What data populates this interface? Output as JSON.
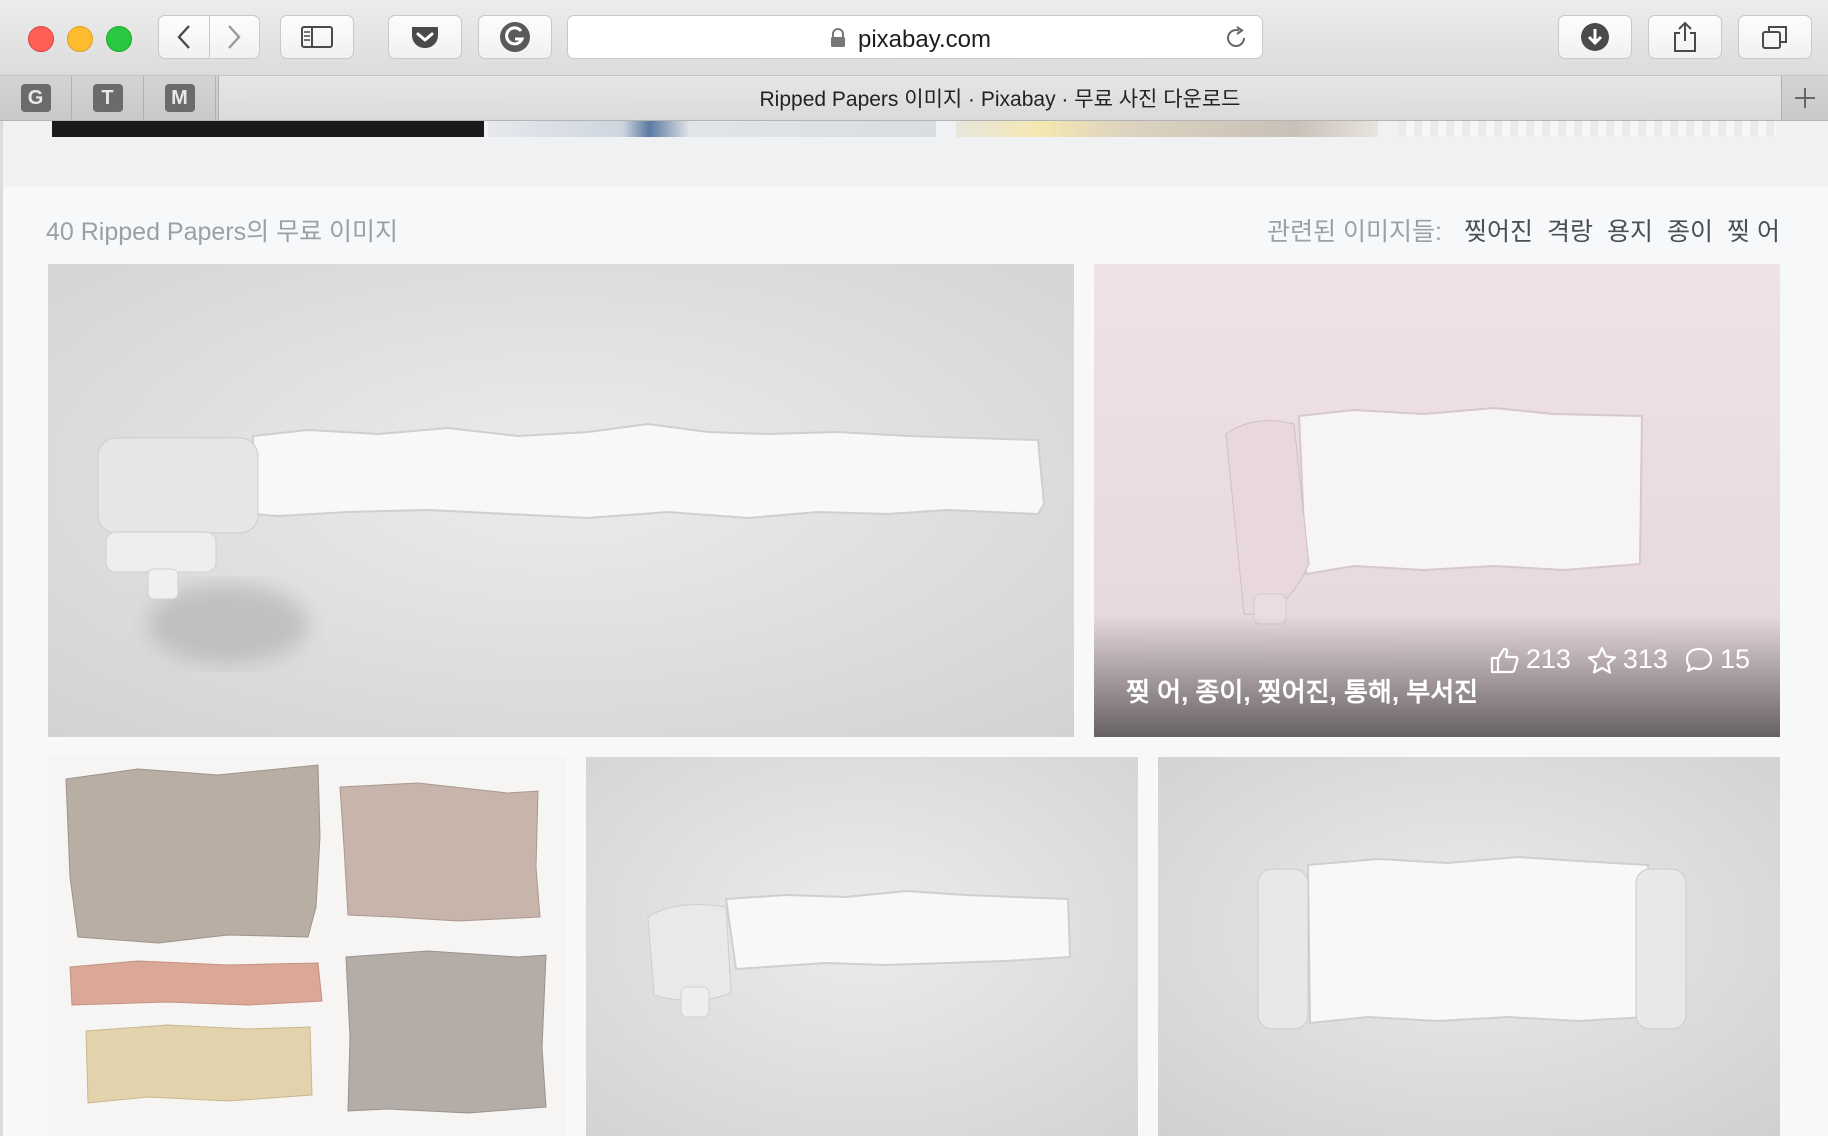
{
  "browser": {
    "url": "pixabay.com",
    "tab_title": "Ripped Papers 이미지 · Pixabay · 무료 사진 다운로드",
    "pinned_tabs": [
      "G",
      "T",
      "M"
    ]
  },
  "results": {
    "title": "40 Ripped Papers의 무료 이미지",
    "related_label": "관련된 이미지들:",
    "related_tags": [
      "찢어진",
      "격랑",
      "용지",
      "종이",
      "찢 어"
    ]
  },
  "hovered_image": {
    "likes": "213",
    "favorites": "313",
    "comments": "15",
    "tags": "찢 어, 종이, 찢어진, 통해, 부서진"
  },
  "colors": {
    "tab_bg": "#dadada",
    "page_bg": "#f7f8f9",
    "muted_text": "#9aa0a6",
    "tag_text": "#4a4f55",
    "pink_photo": "#eddde2"
  }
}
